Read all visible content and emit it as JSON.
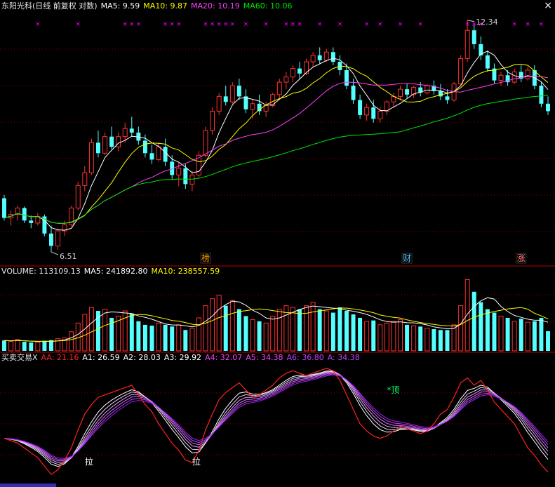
{
  "price_header": {
    "title": "东阳光科(日线 前复权 对数)",
    "ma5": "MA5: 9.59",
    "ma10": "MA10: 9.87",
    "ma20": "MA20: 10.19",
    "ma60": "MA60: 10.06"
  },
  "volume_header": {
    "title": "VOLUME: 113109.13",
    "ma5": "MA5: 241892.80",
    "ma10": "MA10: 238557.59"
  },
  "indicator_header": {
    "title": "买卖交易X",
    "aa": "AA: 21.16",
    "a1": "A1: 26.59",
    "a2": "A2: 28.03",
    "a3": "A3: 29.92",
    "a4": "A4: 32.07",
    "a5": "A5: 34.38",
    "a6": "A6: 36.80",
    "a": "A: 34.38"
  },
  "annotations": {
    "high_label": "12.34",
    "low_label": "6.51",
    "event_bang": "榜",
    "event_cai": "财",
    "event_zhang": "涨",
    "signal_ding": "*顶",
    "signal_la1": "拉",
    "signal_la2": "拉"
  },
  "close_glyph": "×",
  "colors": {
    "up": "#ff3232",
    "down": "#54ffff",
    "ma5": "#ffffff",
    "ma10": "#ffff00",
    "ma20": "#ff40ff",
    "ma60": "#00e600",
    "grid": "#8b0000",
    "aa": "#ff2020",
    "band": "#ff00ff"
  },
  "chart_data": [
    {
      "type": "candlestick",
      "title": "东阳光科(日线 前复权 对数)",
      "y_scale": "log",
      "ylim": [
        6.3,
        12.6
      ],
      "low_marked": 6.51,
      "high_marked": 12.34,
      "candles": [
        [
          7.55,
          7.62,
          7.1,
          7.15
        ],
        [
          7.15,
          7.3,
          7.0,
          7.22
        ],
        [
          7.22,
          7.4,
          7.1,
          7.35
        ],
        [
          7.35,
          7.38,
          7.05,
          7.1
        ],
        [
          7.1,
          7.2,
          6.95,
          7.05
        ],
        [
          7.05,
          7.25,
          7.0,
          7.18
        ],
        [
          7.18,
          7.22,
          6.8,
          6.85
        ],
        [
          6.85,
          7.0,
          6.51,
          6.62
        ],
        [
          6.62,
          6.95,
          6.55,
          6.9
        ],
        [
          6.9,
          7.1,
          6.8,
          7.02
        ],
        [
          7.02,
          7.4,
          6.98,
          7.35
        ],
        [
          7.35,
          7.9,
          7.3,
          7.82
        ],
        [
          7.82,
          8.25,
          7.7,
          8.1
        ],
        [
          8.1,
          8.9,
          8.05,
          8.8
        ],
        [
          8.8,
          9.1,
          8.45,
          8.55
        ],
        [
          8.55,
          9.05,
          8.5,
          8.95
        ],
        [
          8.95,
          9.2,
          8.65,
          8.7
        ],
        [
          8.7,
          9.05,
          8.6,
          8.95
        ],
        [
          8.95,
          9.3,
          8.8,
          9.15
        ],
        [
          9.15,
          9.45,
          8.95,
          9.05
        ],
        [
          9.05,
          9.2,
          8.75,
          8.85
        ],
        [
          8.85,
          9.0,
          8.45,
          8.55
        ],
        [
          8.55,
          8.75,
          8.3,
          8.4
        ],
        [
          8.4,
          8.8,
          8.35,
          8.7
        ],
        [
          8.7,
          8.9,
          8.25,
          8.35
        ],
        [
          8.35,
          8.5,
          7.95,
          8.05
        ],
        [
          8.05,
          8.35,
          7.8,
          8.2
        ],
        [
          8.2,
          8.3,
          7.75,
          7.85
        ],
        [
          7.85,
          8.15,
          7.7,
          8.05
        ],
        [
          8.05,
          8.6,
          8.0,
          8.5
        ],
        [
          8.5,
          9.2,
          8.45,
          9.1
        ],
        [
          9.1,
          9.7,
          9.0,
          9.6
        ],
        [
          9.6,
          10.1,
          9.5,
          10.0
        ],
        [
          10.0,
          10.3,
          9.75,
          9.85
        ],
        [
          9.85,
          10.4,
          9.8,
          10.3
        ],
        [
          10.3,
          10.5,
          9.9,
          10.0
        ],
        [
          10.0,
          10.2,
          9.55,
          9.65
        ],
        [
          9.65,
          9.9,
          9.4,
          9.8
        ],
        [
          9.8,
          10.05,
          9.5,
          9.6
        ],
        [
          9.6,
          9.85,
          9.45,
          9.75
        ],
        [
          9.75,
          10.1,
          9.7,
          10.05
        ],
        [
          10.05,
          10.5,
          9.95,
          10.4
        ],
        [
          10.4,
          10.7,
          10.2,
          10.55
        ],
        [
          10.55,
          10.9,
          10.4,
          10.8
        ],
        [
          10.8,
          11.0,
          10.5,
          10.65
        ],
        [
          10.65,
          11.1,
          10.6,
          11.0
        ],
        [
          11.0,
          11.3,
          10.85,
          11.2
        ],
        [
          11.2,
          11.45,
          10.95,
          11.05
        ],
        [
          11.05,
          11.4,
          11.0,
          11.3
        ],
        [
          11.3,
          11.45,
          10.9,
          11.0
        ],
        [
          11.0,
          11.2,
          10.6,
          10.75
        ],
        [
          10.75,
          10.95,
          10.2,
          10.3
        ],
        [
          10.3,
          10.5,
          9.8,
          9.9
        ],
        [
          9.9,
          10.05,
          9.4,
          9.5
        ],
        [
          9.5,
          9.8,
          9.35,
          9.7
        ],
        [
          9.7,
          9.9,
          9.3,
          9.4
        ],
        [
          9.4,
          9.7,
          9.3,
          9.6
        ],
        [
          9.6,
          9.9,
          9.5,
          9.85
        ],
        [
          9.85,
          10.1,
          9.7,
          10.0
        ],
        [
          10.0,
          10.3,
          9.9,
          10.2
        ],
        [
          10.2,
          10.35,
          9.95,
          10.05
        ],
        [
          10.05,
          10.3,
          9.95,
          10.25
        ],
        [
          10.25,
          10.4,
          10.0,
          10.1
        ],
        [
          10.1,
          10.35,
          10.05,
          10.3
        ],
        [
          10.3,
          10.45,
          10.05,
          10.15
        ],
        [
          10.15,
          10.35,
          9.9,
          10.0
        ],
        [
          10.0,
          10.2,
          9.8,
          9.9
        ],
        [
          9.9,
          10.4,
          9.85,
          10.35
        ],
        [
          10.35,
          11.2,
          10.3,
          11.1
        ],
        [
          11.1,
          12.34,
          11.0,
          12.0
        ],
        [
          12.0,
          12.2,
          11.4,
          11.55
        ],
        [
          11.55,
          11.8,
          11.05,
          11.2
        ],
        [
          11.2,
          11.35,
          10.7,
          10.8
        ],
        [
          10.8,
          10.95,
          10.35,
          10.45
        ],
        [
          10.45,
          10.7,
          10.3,
          10.6
        ],
        [
          10.6,
          10.75,
          10.3,
          10.4
        ],
        [
          10.4,
          10.8,
          10.35,
          10.7
        ],
        [
          10.7,
          10.9,
          10.4,
          10.5
        ],
        [
          10.5,
          10.85,
          10.45,
          10.75
        ],
        [
          10.75,
          10.9,
          10.2,
          10.3
        ],
        [
          10.3,
          10.4,
          9.7,
          9.8
        ],
        [
          9.8,
          10.0,
          9.5,
          9.6
        ]
      ],
      "series": [
        {
          "name": "MA5",
          "value_last": 9.59
        },
        {
          "name": "MA10",
          "value_last": 9.87
        },
        {
          "name": "MA20",
          "value_last": 10.19
        },
        {
          "name": "MA60",
          "value_last": 10.06
        }
      ]
    },
    {
      "type": "bar",
      "title": "VOLUME: 113109.13",
      "ylim": [
        0,
        420000
      ],
      "values": [
        60000,
        55000,
        65000,
        52000,
        48000,
        50000,
        58000,
        62000,
        70000,
        75000,
        110000,
        160000,
        210000,
        250000,
        230000,
        240000,
        190000,
        200000,
        230000,
        215000,
        170000,
        150000,
        145000,
        160000,
        150000,
        140000,
        150000,
        120000,
        130000,
        190000,
        260000,
        300000,
        320000,
        260000,
        290000,
        240000,
        200000,
        180000,
        170000,
        160000,
        200000,
        240000,
        260000,
        250000,
        240000,
        260000,
        280000,
        240000,
        230000,
        220000,
        250000,
        230000,
        210000,
        190000,
        170000,
        175000,
        150000,
        160000,
        170000,
        180000,
        150000,
        145000,
        140000,
        130000,
        125000,
        120000,
        120000,
        150000,
        260000,
        410000,
        340000,
        280000,
        240000,
        220000,
        200000,
        190000,
        170000,
        185000,
        165000,
        170000,
        190000,
        113109
      ],
      "series": [
        {
          "name": "MA5",
          "value_last": 241892.8
        },
        {
          "name": "MA10",
          "value_last": 238557.59
        }
      ]
    },
    {
      "type": "line",
      "title": "买卖交易X",
      "ylim": [
        0,
        100
      ],
      "aa": [
        38,
        36,
        34,
        30,
        26,
        22,
        15,
        8,
        12,
        20,
        30,
        45,
        58,
        66,
        72,
        74,
        76,
        78,
        80,
        82,
        74,
        66,
        60,
        50,
        42,
        34,
        28,
        20,
        18,
        28,
        45,
        58,
        70,
        76,
        80,
        84,
        78,
        72,
        74,
        78,
        82,
        88,
        92,
        94,
        92,
        90,
        92,
        94,
        96,
        94,
        86,
        74,
        62,
        50,
        44,
        40,
        38,
        40,
        44,
        48,
        46,
        44,
        42,
        44,
        50,
        58,
        62,
        72,
        84,
        88,
        82,
        86,
        78,
        68,
        62,
        56,
        50,
        40,
        30,
        24,
        16,
        10
      ],
      "a_bands": [
        {
          "name": "A1",
          "value_last": 26.59
        },
        {
          "name": "A2",
          "value_last": 28.03
        },
        {
          "name": "A3",
          "value_last": 29.92
        },
        {
          "name": "A4",
          "value_last": 32.07
        },
        {
          "name": "A5",
          "value_last": 34.38
        },
        {
          "name": "A6",
          "value_last": 36.8
        }
      ],
      "a_value_last": 34.38,
      "aa_value_last": 21.16
    }
  ]
}
